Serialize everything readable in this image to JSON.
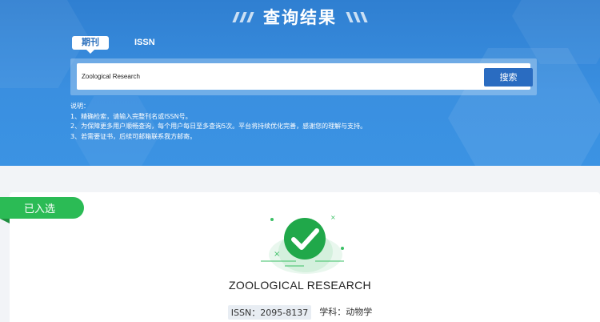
{
  "header": {
    "title": "查询结果"
  },
  "search": {
    "tabs": [
      {
        "label": "期刊",
        "active": true
      },
      {
        "label": "ISSN",
        "active": false
      }
    ],
    "value": "Zoological Research",
    "button_label": "搜索"
  },
  "notes": {
    "heading": "说明：",
    "lines": [
      "1、精确检索，请输入完整刊名或ISSN号。",
      "2、为保障更多用户顺畅查询，每个用户每日至多查询5次。平台将持续优化完善，感谢您的理解与支持。",
      "3、若需要证书，后续可邮箱联系我方邮寄。"
    ]
  },
  "result": {
    "status_badge": "已入选",
    "status_icon": "check-circle-icon",
    "journal_name": "ZOOLOGICAL RESEARCH",
    "issn_label": "ISSN：2095-8137",
    "subject_label": "学科：动物学"
  },
  "colors": {
    "banner": "#3a8fe0",
    "search_button": "#2a6cc1",
    "badge": "#2bbb55",
    "check": "#20a84a"
  }
}
